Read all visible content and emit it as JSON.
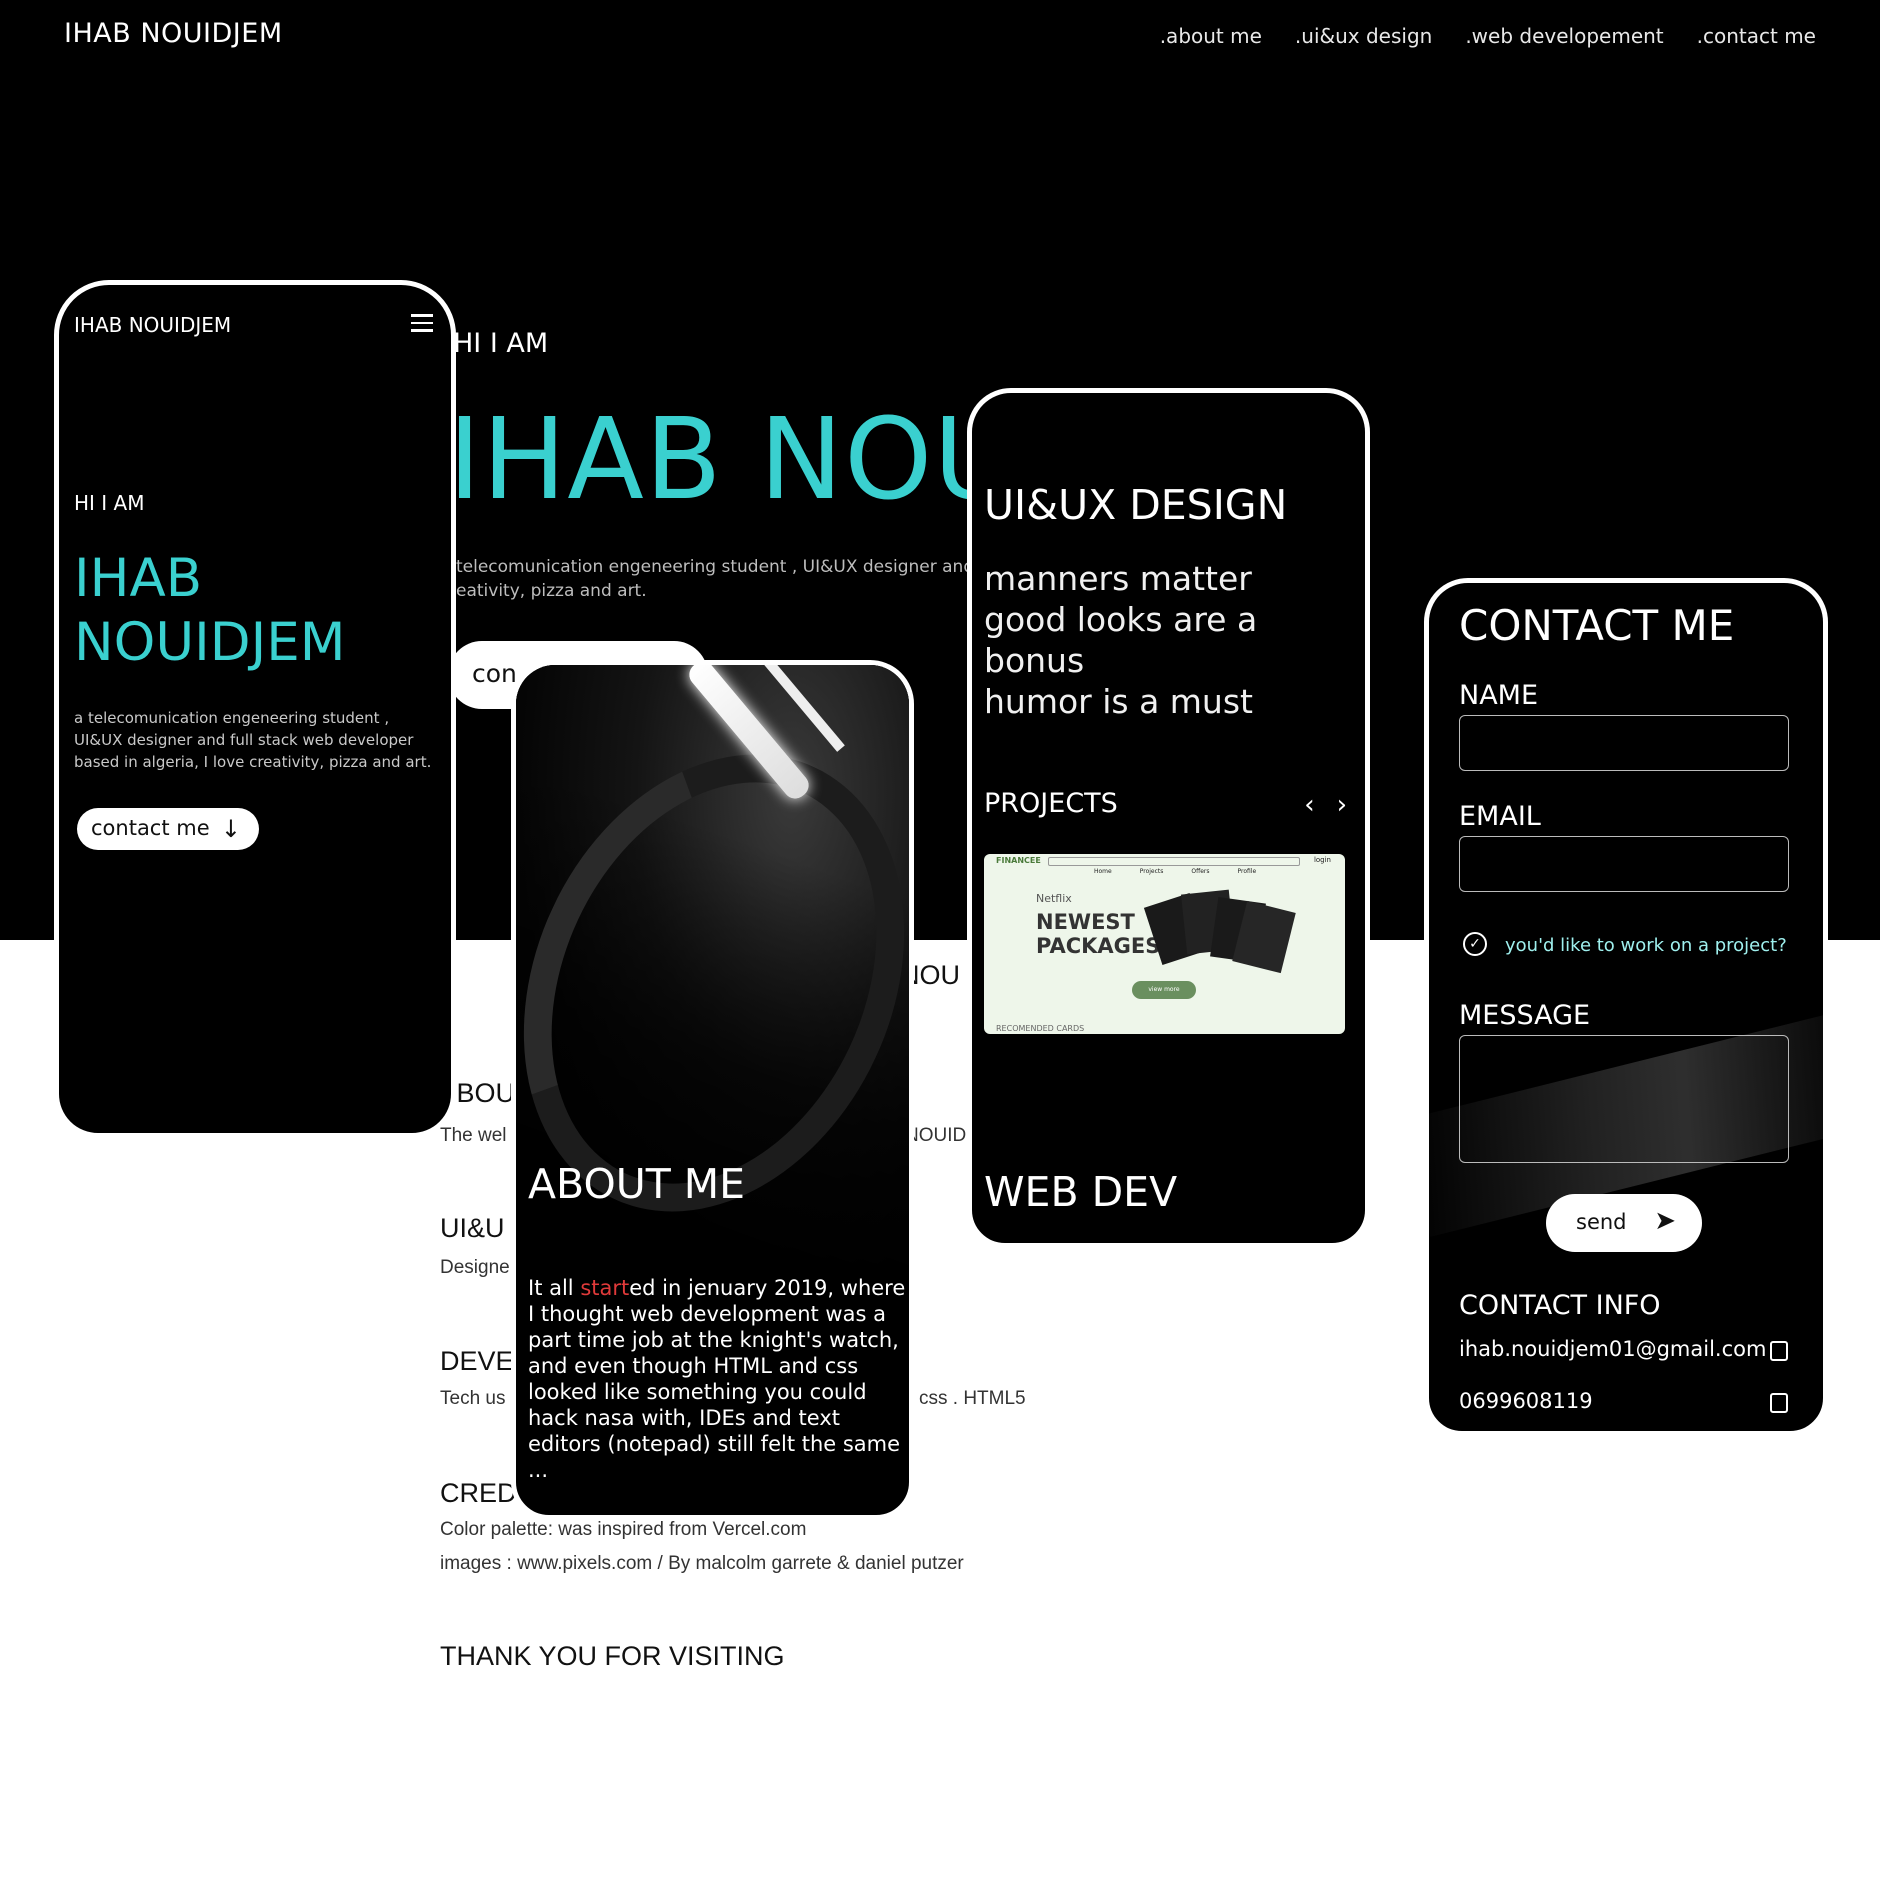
{
  "header": {
    "logo": "IHAB NOUIDJEM",
    "nav": [
      ".about me",
      ".ui&ux design",
      ".web developement",
      ".contact me"
    ]
  },
  "desktop": {
    "hi": "HI I AM",
    "name": "IHAB NOU",
    "desc_line1": "telecomunication engeneering student , UI&UX designer and",
    "desc_line2": "eativity, pizza and art.",
    "contact": "con",
    "lower": {
      "nou": "NOU",
      "about_head": ".BOU",
      "about_text": "The wel",
      "about_right": "NOUID",
      "uiux_head": "UI&U",
      "uiux_text": "Designe",
      "dev_head": "DEVE",
      "dev_text": "Tech us",
      "dev_right": "css . HTML5",
      "cred_head": "CRED",
      "cred_line1": "Color palette: was inspired from Vercel.com",
      "cred_line2": "images : www.pixels.com / By malcolm garrete & daniel putzer",
      "thanks": "THANK YOU FOR VISITING"
    }
  },
  "phone_hero": {
    "logo": "IHAB NOUIDJEM",
    "hi": "HI I AM",
    "name_line1": "IHAB",
    "name_line2": "NOUIDJEM",
    "desc": "a telecomunication engeneering student , UI&UX designer and full stack web developer based in algeria, I love creativity, pizza and art.",
    "button": "contact me"
  },
  "phone_about": {
    "title": "ABOUT ME",
    "body_pre": "It all ",
    "body_red": "start",
    "body_post": "ed in jenuary 2019, where I thought web development was a part time job at the knight's watch, and even though HTML and css looked like something you could hack nasa with, IDEs and text editors (notepad) still felt the same ..."
  },
  "phone_uiux": {
    "title": "UI&UX DESIGN",
    "motto1": "manners matter",
    "motto2": "good looks are a bonus",
    "motto3": "humor is a must",
    "projects": "PROJECTS",
    "thumb": {
      "brand": "FINANCEE",
      "login": "login",
      "nav": [
        "Home",
        "Projects",
        "Offers",
        "Profile"
      ],
      "small": "Netflix",
      "headline1": "NEWEST",
      "headline2": "PACKAGES",
      "cta": "view more",
      "footer": "RECOMENDED CARDS"
    },
    "webdev": "WEB DEV"
  },
  "phone_contact": {
    "title": "CONTACT ME",
    "name_label": "NAME",
    "email_label": "EMAIL",
    "question": "you'd like to work on a project?",
    "message_label": "MESSAGE",
    "send": "send",
    "info_title": "CONTACT INFO",
    "email": "ihab.nouidjem01@gmail.com",
    "phone": "0699608119"
  },
  "colors": {
    "accent": "#3ad0cf",
    "background": "#000000",
    "highlight": "#e03a3a"
  },
  "icons": [
    "menu-icon",
    "arrow-down-icon",
    "chevron-left-icon",
    "chevron-right-icon",
    "check-circle-icon",
    "send-icon",
    "copy-icon"
  ]
}
